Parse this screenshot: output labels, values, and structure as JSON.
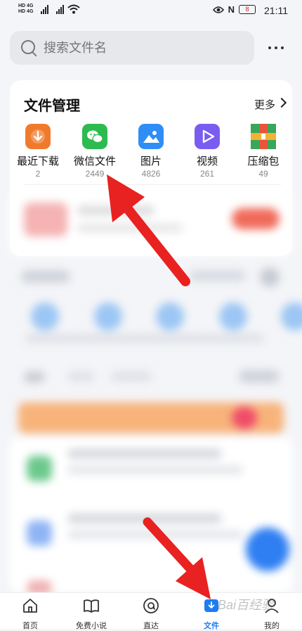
{
  "status_bar": {
    "left_top": "HD 4G",
    "left_bottom": "HD 4G",
    "time": "21:11",
    "battery": "8",
    "nfc": "N"
  },
  "search": {
    "placeholder": "搜索文件名"
  },
  "file_management": {
    "title": "文件管理",
    "more_label": "更多",
    "categories": [
      {
        "label": "最近下载",
        "count": "2",
        "icon": "download-icon",
        "color": "#f07a2c"
      },
      {
        "label": "微信文件",
        "count": "2449",
        "icon": "wechat-icon",
        "color": "#2dbb4f"
      },
      {
        "label": "图片",
        "count": "4826",
        "icon": "image-icon",
        "color": "#2f8ef5"
      },
      {
        "label": "视频",
        "count": "261",
        "icon": "video-icon",
        "color": "#7a5cf0"
      },
      {
        "label": "压缩包",
        "count": "49",
        "icon": "zip-icon",
        "color": "#e8553a"
      }
    ]
  },
  "tab_bar": {
    "tabs": [
      {
        "label": "首页",
        "icon": "home-icon"
      },
      {
        "label": "免费小说",
        "icon": "book-icon"
      },
      {
        "label": "直达",
        "icon": "direct-icon"
      },
      {
        "label": "文件",
        "icon": "file-download-icon",
        "active": true
      },
      {
        "label": "我的",
        "icon": "profile-icon"
      }
    ],
    "active_color": "#1e7cf2"
  },
  "watermark": "Bai百经验",
  "colors": {
    "arrow": "#e82121",
    "accent": "#1e7cf2"
  }
}
